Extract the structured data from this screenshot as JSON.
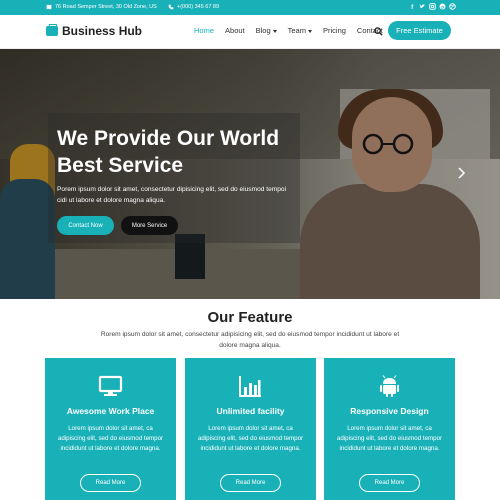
{
  "topbar": {
    "address": "76 Road Semper Street, 30 Old Zone, US",
    "phone": "+(000) 345 67 89",
    "social": [
      "facebook-icon",
      "twitter-icon",
      "instagram-icon",
      "pinterest-icon",
      "dribbble-icon"
    ]
  },
  "nav": {
    "brand": "Business Hub",
    "items": [
      "Home",
      "About",
      "Blog",
      "Team",
      "Pricing",
      "Contact"
    ],
    "cta": "Free Estimate"
  },
  "hero": {
    "title": "We Provide Our World Best Service",
    "text": "Porem ipsum dolor sit amet, consectetur dipisicing elit, sed do eiusmod tempoi cidi ut labore et dolore magna aliqua.",
    "primary_button": "Contact Now",
    "secondary_button": "More Service"
  },
  "features": {
    "title": "Our Feature",
    "text": "Rorem ipsum dolor sit amet, consectetur adipisicing elit, sed do eiusmod tempor incididunt ut labore et dolore magna aliqua.",
    "cards": [
      {
        "icon": "monitor-icon",
        "title": "Awesome Work Place",
        "text": "Lorem ipsum dolor sit amet, ca adipiscing elit, sed do eiusmod tempor incididunt ut labore et dolore magna.",
        "button": "Read More"
      },
      {
        "icon": "bar-chart-icon",
        "title": "Unlimited facility",
        "text": "Lorem ipsum dolor sit amet, ca adipiscing elit, sed do eiusmod tempor incididunt ut labore et dolore magna.",
        "button": "Read More"
      },
      {
        "icon": "android-icon",
        "title": "Responsive Design",
        "text": "Lorem ipsum dolor sit amet, ca adipiscing elit, sed do eiusmod tempor incididunt ut labore et dolore magna.",
        "button": "Read More"
      }
    ]
  },
  "colors": {
    "accent": "#19b1b8",
    "dark": "#111111"
  }
}
